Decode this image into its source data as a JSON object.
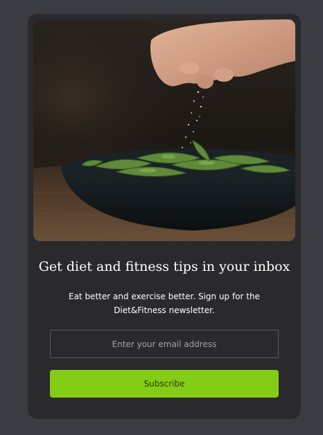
{
  "hero": {
    "image": "hand-sprinkling-salt-on-edamame-bowl"
  },
  "newsletter": {
    "title": "Get diet and fitness tips in your inbox",
    "subtitle": "Eat better and exercise better. Sign up for the Diet&Fitness newsletter.",
    "email_placeholder": "Enter your email address",
    "email_value": "",
    "subscribe_label": "Subscribe"
  },
  "colors": {
    "page_background": "#3b3c41",
    "card_background": "#2a2a2c",
    "accent": "#84cc16",
    "input_border": "#5b5b60"
  }
}
